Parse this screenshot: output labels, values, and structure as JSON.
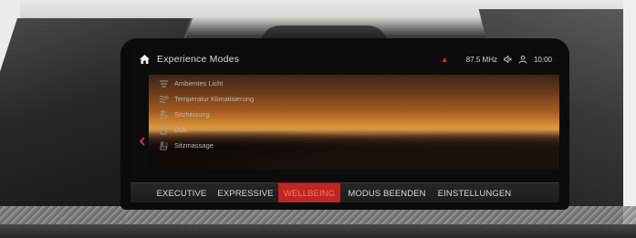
{
  "header": {
    "title": "Experience Modes",
    "radio_frequency": "87.5 MHz",
    "clock": "10:00"
  },
  "menu": {
    "items": [
      {
        "label": "Ambientes Licht",
        "icon": "ambient-light-icon"
      },
      {
        "label": "Temperatur Klimatisierung",
        "icon": "climate-icon"
      },
      {
        "label": "Sitzheizung",
        "icon": "seat-heating-icon"
      },
      {
        "label": "Duft",
        "icon": "fragrance-icon"
      },
      {
        "label": "Sitzmassage",
        "icon": "seat-massage-icon"
      }
    ]
  },
  "tabs": [
    {
      "label": "EXECUTIVE",
      "active": false
    },
    {
      "label": "EXPRESSIVE",
      "active": false
    },
    {
      "label": "WELLBEING",
      "active": true
    },
    {
      "label": "MODUS BEENDEN",
      "active": false
    },
    {
      "label": "EINSTELLUNGEN",
      "active": false
    }
  ],
  "colors": {
    "accent": "#c0251f",
    "background": "#0d0c0c"
  }
}
